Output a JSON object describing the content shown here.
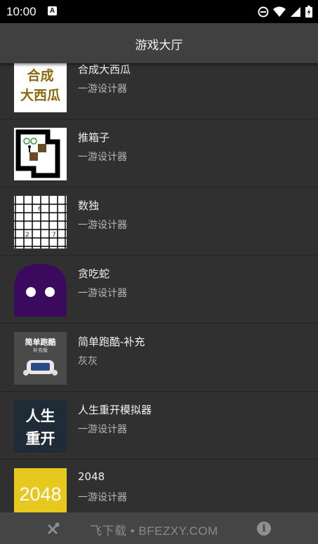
{
  "status_bar": {
    "time": "10:00",
    "notification_letter": "A"
  },
  "app_bar": {
    "title": "游戏大厅"
  },
  "games": [
    {
      "name": "合成大西瓜",
      "author": "一游设计器",
      "thumb_text": [
        "合成",
        "大西瓜"
      ]
    },
    {
      "name": "推箱子",
      "author": "一游设计器"
    },
    {
      "name": "数独",
      "author": "一游设计器",
      "thumb_numbers": [
        "6",
        "2",
        "7"
      ]
    },
    {
      "name": "贪吃蛇",
      "author": "一游设计器"
    },
    {
      "name": "简单跑酷-补充",
      "author": "灰灰",
      "thumb_text": [
        "简单跑酷",
        "补充版"
      ]
    },
    {
      "name": "人生重开模拟器",
      "author": "一游设计器",
      "thumb_text": [
        "人生",
        "重开"
      ]
    },
    {
      "name": "2048",
      "author": "一游设计器",
      "thumb_text": [
        "2048"
      ]
    }
  ],
  "watermark": "飞下载 • BFEZXY.COM",
  "bottom_bar": {
    "info_label": "i"
  },
  "colors": {
    "background": "#303030",
    "app_bar": "#404040",
    "bottom_bar": "#454545",
    "watermelon_text": "#8b6a12",
    "snake": "#3b0a5e",
    "game2048": "#e6c81e",
    "life_restart": "#1f2b36"
  }
}
